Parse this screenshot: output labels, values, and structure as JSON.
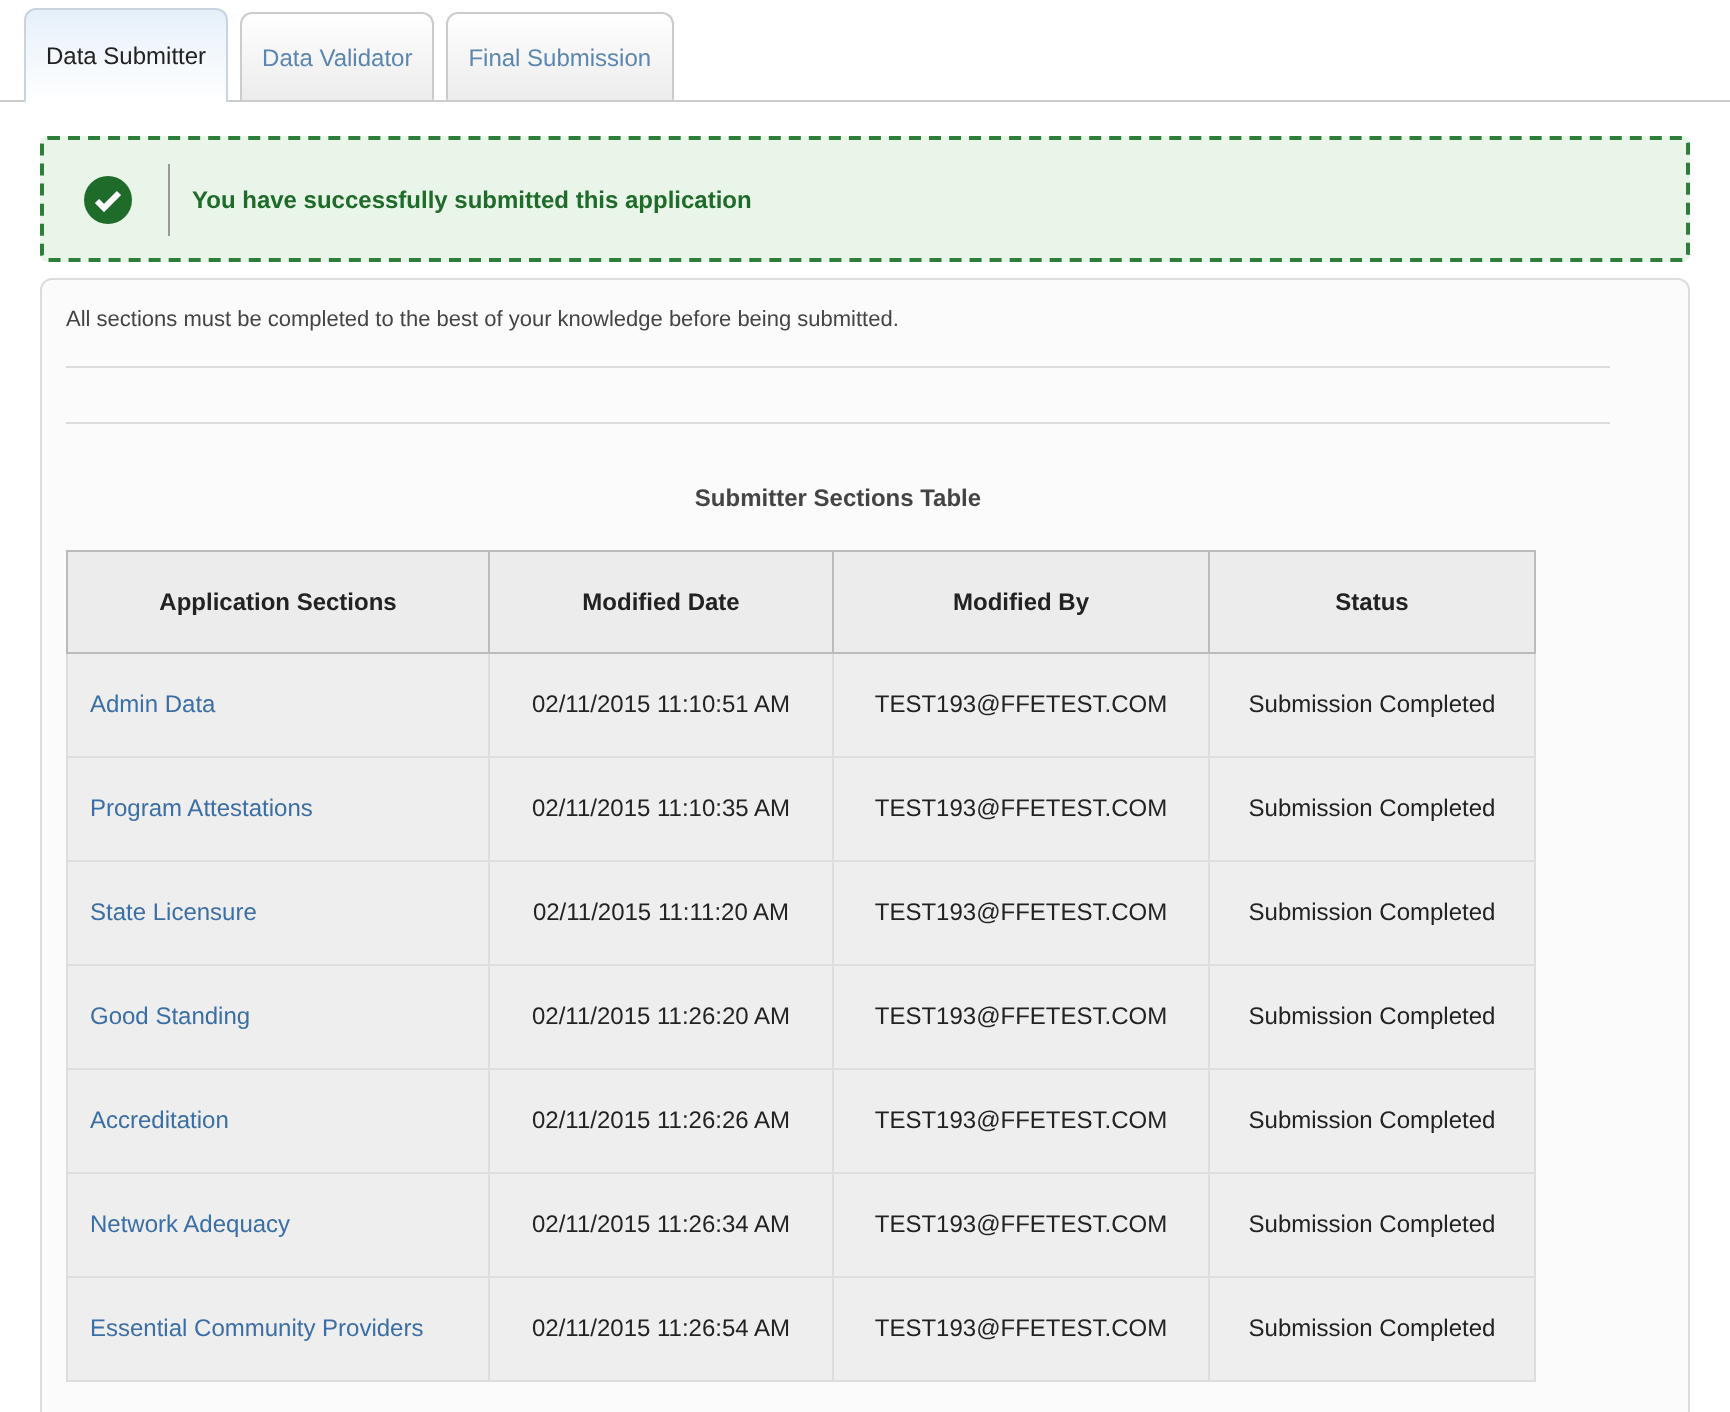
{
  "tabs": [
    {
      "label": "Data Submitter",
      "selected": true
    },
    {
      "label": "Data Validator",
      "selected": false
    },
    {
      "label": "Final Submission",
      "selected": false
    }
  ],
  "alert": {
    "message": "You have successfully submitted this application"
  },
  "instructions": "All sections must be completed to the best of your knowledge before being submitted.",
  "table": {
    "title": "Submitter Sections Table",
    "columns": [
      "Application Sections",
      "Modified Date",
      "Modified By",
      "Status"
    ],
    "rows": [
      {
        "section": "Admin Data",
        "date": "02/11/2015 11:10:51 AM",
        "by": "TEST193@FFETEST.COM",
        "status": "Submission Completed"
      },
      {
        "section": "Program Attestations",
        "date": "02/11/2015 11:10:35 AM",
        "by": "TEST193@FFETEST.COM",
        "status": "Submission Completed"
      },
      {
        "section": "State Licensure",
        "date": "02/11/2015 11:11:20 AM",
        "by": "TEST193@FFETEST.COM",
        "status": "Submission Completed"
      },
      {
        "section": "Good Standing",
        "date": "02/11/2015 11:26:20 AM",
        "by": "TEST193@FFETEST.COM",
        "status": "Submission Completed"
      },
      {
        "section": "Accreditation",
        "date": "02/11/2015 11:26:26 AM",
        "by": "TEST193@FFETEST.COM",
        "status": "Submission Completed"
      },
      {
        "section": "Network Adequacy",
        "date": "02/11/2015 11:26:34 AM",
        "by": "TEST193@FFETEST.COM",
        "status": "Submission Completed"
      },
      {
        "section": "Essential Community Providers",
        "date": "02/11/2015 11:26:54 AM",
        "by": "TEST193@FFETEST.COM",
        "status": "Submission Completed"
      }
    ]
  }
}
